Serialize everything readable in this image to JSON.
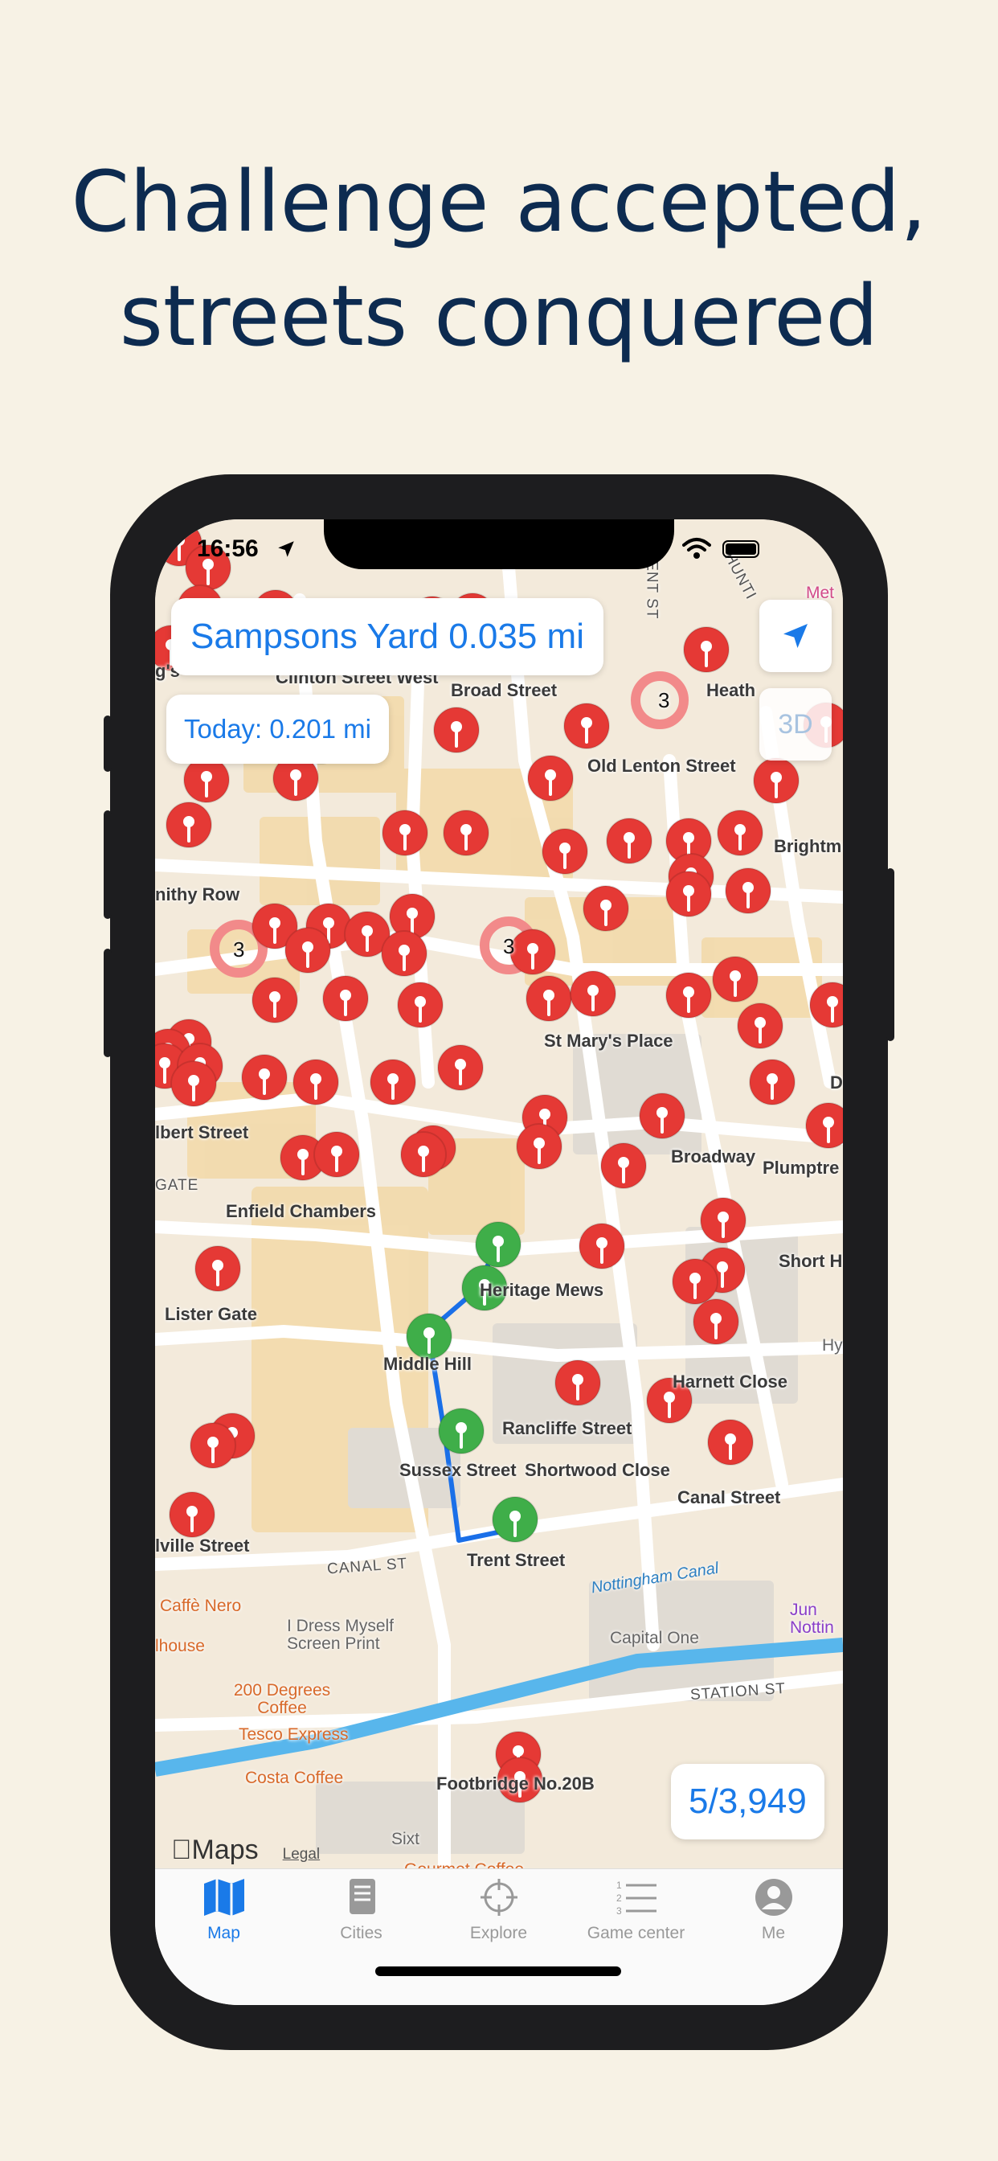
{
  "headline": {
    "line1": "Challenge accepted,",
    "line2": "streets conquered"
  },
  "status_bar": {
    "time": "16:56"
  },
  "current_street_card": "Sampsons Yard 0.035 mi",
  "today_card": "Today: 0.201 mi",
  "three_d_label": "3D",
  "progress_count": "5/3,949",
  "cluster_labels": [
    "3",
    "3",
    "3"
  ],
  "map_labels": {
    "street_names": [
      "Clinton Street West",
      "Broad Street",
      "Heath",
      "Old Lenton Street",
      "Brightm",
      "nithy Row",
      "St Mary's Place",
      "lbert Street",
      "Broadway",
      "Plumptre",
      "Enfield Chambers",
      "Heritage Mews",
      "Short H",
      "Lister Gate",
      "Middle Hill",
      "Harnett Close",
      "Rancliffe Street",
      "Sussex Street",
      "Shortwood Close",
      "Canal Street",
      "lville Street",
      "Trent Street",
      "Footbridge No.20B",
      "D",
      "g's"
    ],
    "road_labels": [
      "CANAL ST",
      "STATION ST",
      "GATE",
      "HUNTI",
      "VENT ST"
    ],
    "canal_label": "Nottingham Canal",
    "places": [
      "Caffè Nero",
      "lhouse",
      "I Dress Myself Screen Print",
      "200 Degrees Coffee",
      "Tesco Express",
      "Costa Coffee",
      "Capital One",
      "Sixt",
      "Gourmet Coffee",
      "Jun Nottin",
      "Met",
      "Hy"
    ]
  },
  "attribution": {
    "brand": "Maps",
    "legal": "Legal"
  },
  "tabs": [
    {
      "label": "Map",
      "icon": "map-icon"
    },
    {
      "label": "Cities",
      "icon": "book-icon"
    },
    {
      "label": "Explore",
      "icon": "crosshair-icon"
    },
    {
      "label": "Game center",
      "icon": "ranked-list-icon"
    },
    {
      "label": "Me",
      "icon": "person-icon"
    }
  ],
  "colors": {
    "accent": "#1a7ae8",
    "headline": "#0d2b50",
    "background": "#f7f2e5",
    "unvisited_pin": "#e53935",
    "visited_pin": "#3fae49",
    "route": "#1a6fe8"
  }
}
